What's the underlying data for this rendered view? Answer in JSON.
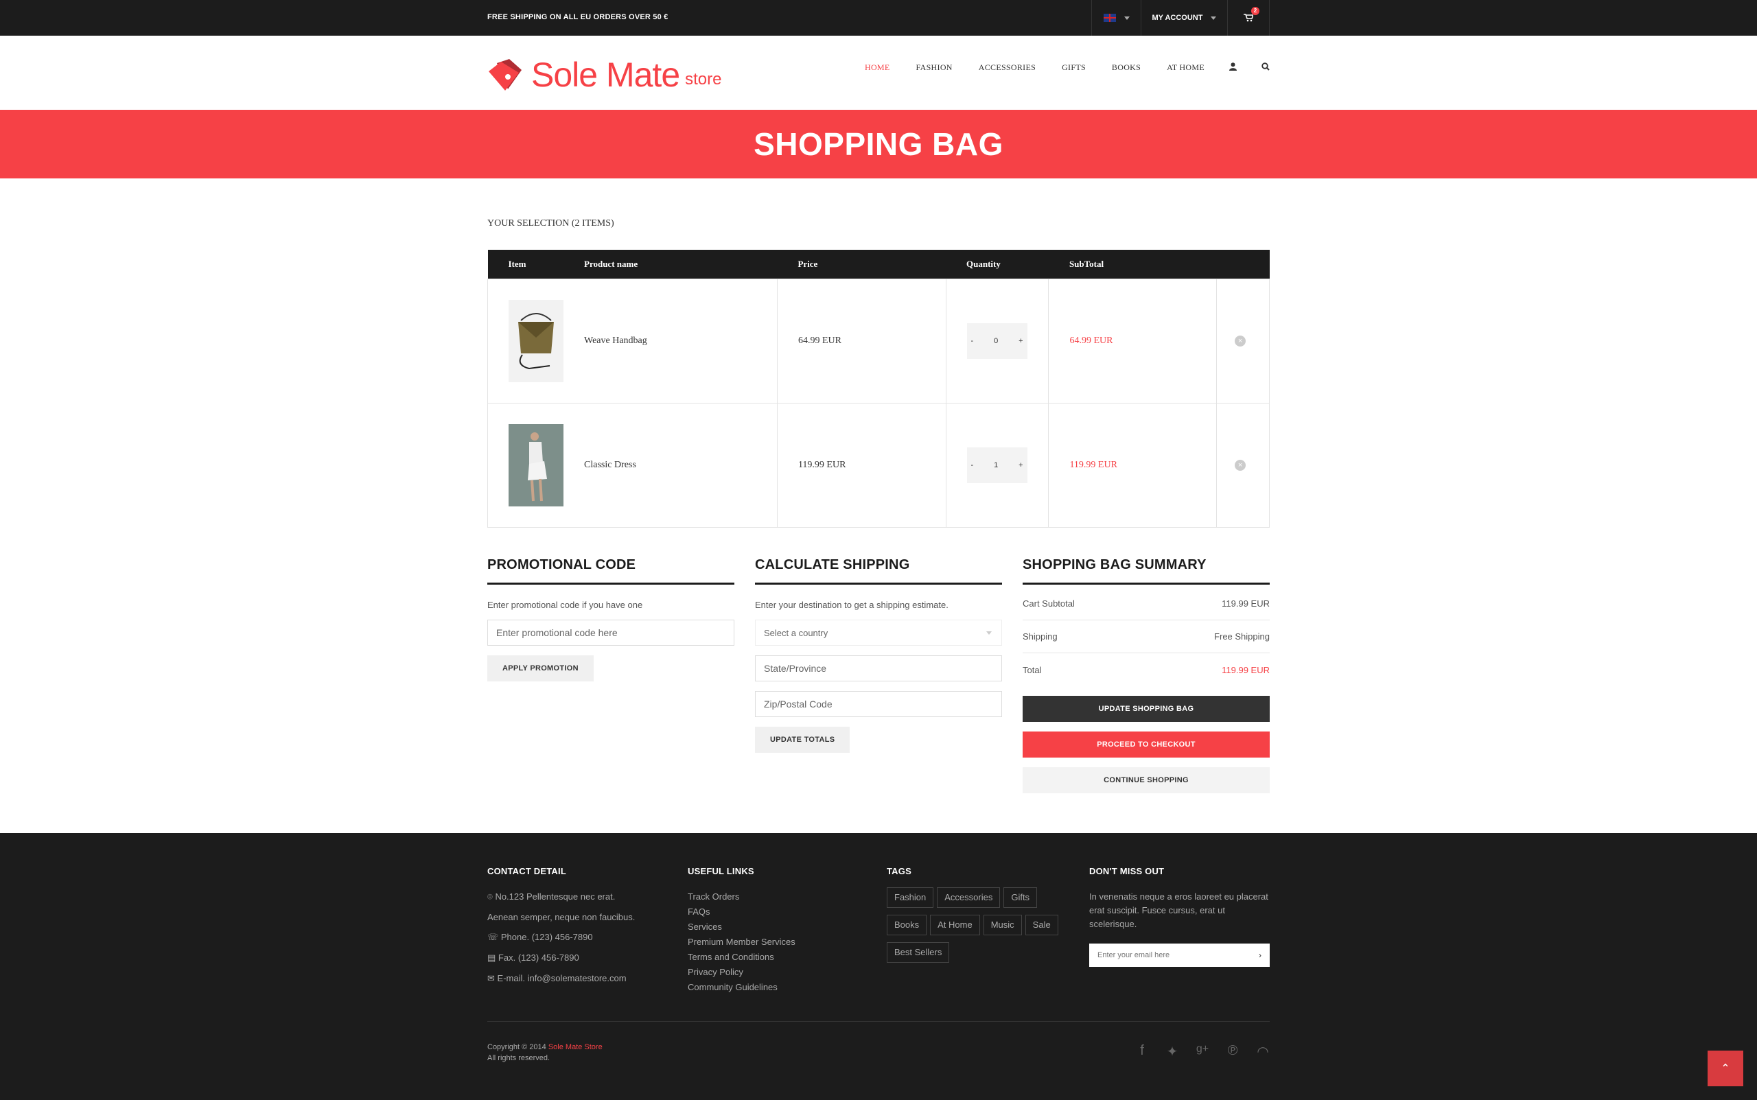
{
  "topbar": {
    "shipping_notice": "FREE SHIPPING ON ALL EU ORDERS OVER 50 €",
    "language_icon": "uk-flag-icon",
    "account_label": "MY ACCOUNT",
    "cart_count": "2"
  },
  "header": {
    "logo_text": "Sole Mate",
    "logo_sub": "store",
    "nav": [
      "HOME",
      "FASHION",
      "ACCESSORIES",
      "GIFTS",
      "BOOKS",
      "AT HOME"
    ],
    "active_nav": "HOME"
  },
  "banner": {
    "title": "SHOPPING BAG"
  },
  "selection": {
    "title": "YOUR SELECTION (2 ITEMS)"
  },
  "table": {
    "headers": {
      "item": "Item",
      "product": "Product name",
      "price": "Price",
      "quantity": "Quantity",
      "subtotal": "SubTotal"
    },
    "rows": [
      {
        "name": "Weave Handbag",
        "price": "64.99 EUR",
        "qty": "0",
        "subtotal": "64.99 EUR"
      },
      {
        "name": "Classic Dress",
        "price": "119.99 EUR",
        "qty": "1",
        "subtotal": "119.99 EUR"
      }
    ],
    "minus": "-",
    "plus": "+"
  },
  "promo": {
    "title": "PROMOTIONAL CODE",
    "hint": "Enter promotional code if you have one",
    "placeholder": "Enter promotional code here",
    "button": "APPLY PROMOTION"
  },
  "shipping": {
    "title": "CALCULATE SHIPPING",
    "hint": "Enter your destination to get a shipping estimate.",
    "country_placeholder": "Select a country",
    "state_placeholder": "State/Province",
    "zip_placeholder": "Zip/Postal Code",
    "button": "UPDATE TOTALS"
  },
  "summary": {
    "title": "SHOPPING BAG SUMMARY",
    "cart_subtotal_label": "Cart Subtotal",
    "cart_subtotal_value": "119.99 EUR",
    "shipping_label": "Shipping",
    "shipping_value": "Free Shipping",
    "total_label": "Total",
    "total_value": "119.99 EUR",
    "update_button": "UPDATE SHOPPING BAG",
    "checkout_button": "PROCEED TO CHECKOUT",
    "continue_button": "CONTINUE SHOPPING"
  },
  "footer": {
    "contact": {
      "title": "CONTACT DETAIL",
      "address1": "No.123 Pellentesque nec erat.",
      "address2": "Aenean semper, neque non faucibus.",
      "phone": "Phone. (123) 456-7890",
      "fax": "Fax. (123) 456-7890",
      "email": "E-mail. info@solematestore.com"
    },
    "links": {
      "title": "USEFUL LINKS",
      "items": [
        "Track Orders",
        "FAQs",
        "Services",
        "Premium Member Services",
        "Terms and Conditions",
        "Privacy Policy",
        "Community Guidelines"
      ]
    },
    "tags": {
      "title": "TAGS",
      "items": [
        "Fashion",
        "Accessories",
        "Gifts",
        "Books",
        "At Home",
        "Music",
        "Sale",
        "Best Sellers"
      ]
    },
    "newsletter": {
      "title": "DON'T MISS OUT",
      "text": "In venenatis neque a eros laoreet eu placerat erat suscipit. Fusce cursus, erat ut scelerisque.",
      "placeholder": "Enter your email here"
    },
    "copyright_prefix": "Copyright © 2014 ",
    "copyright_brand": "Sole Mate Store",
    "rights": "All rights reserved."
  },
  "colors": {
    "accent": "#f64146",
    "dark": "#1c1c1c"
  }
}
